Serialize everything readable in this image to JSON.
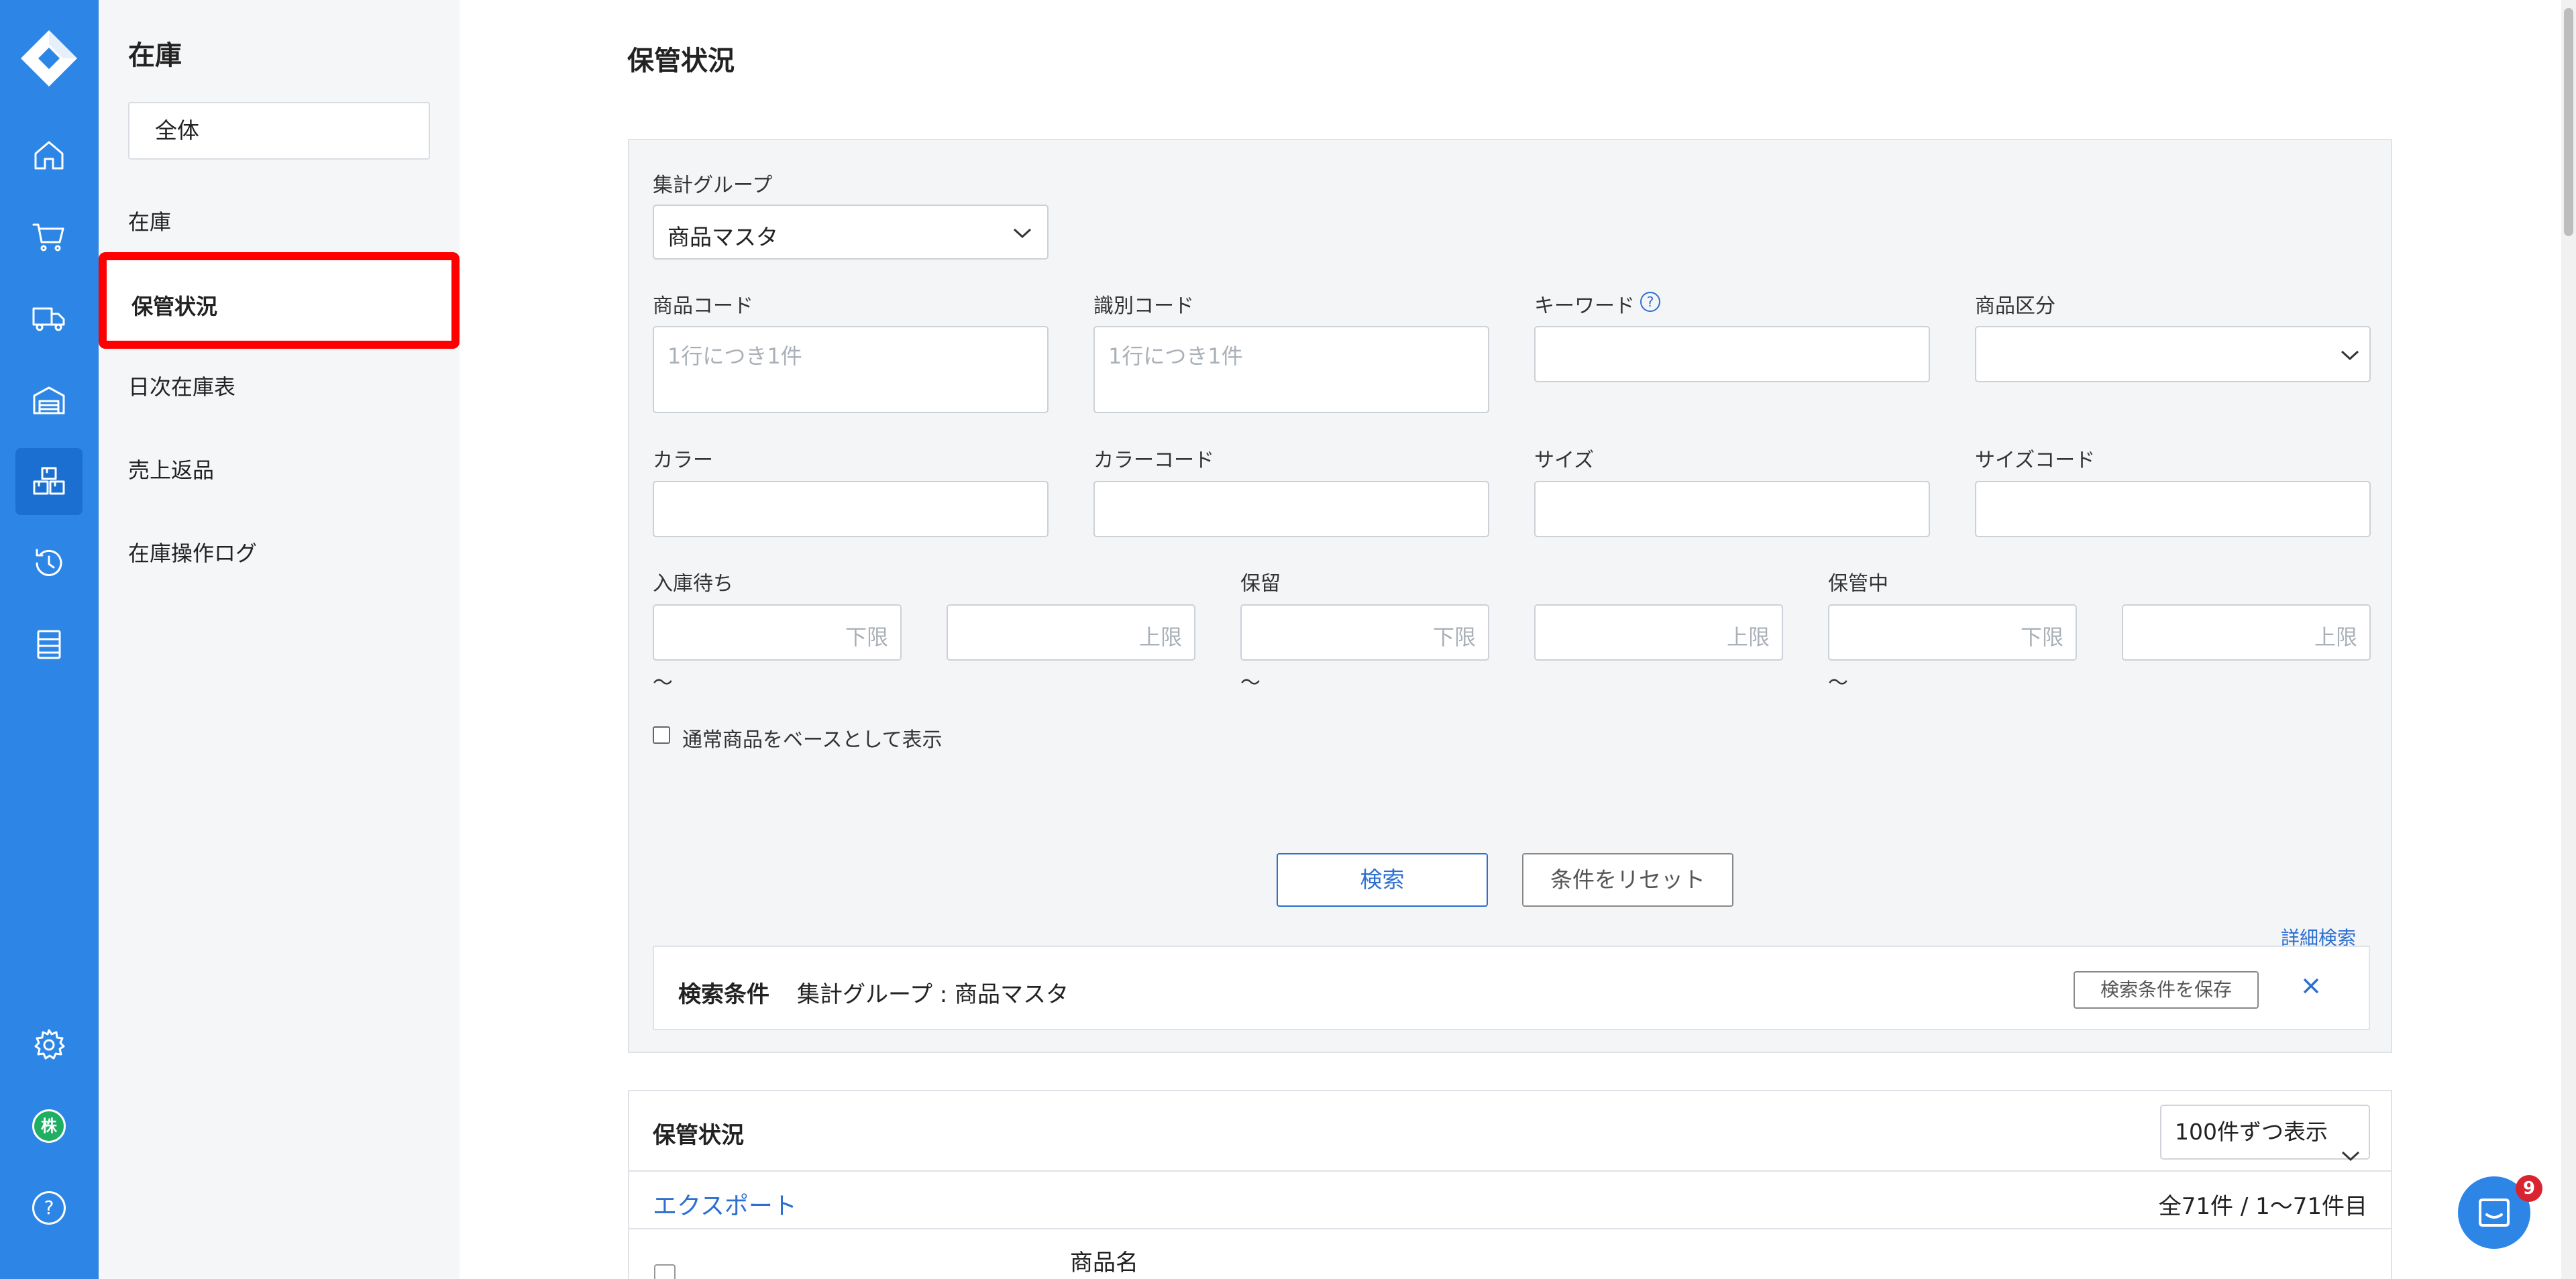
{
  "rail": {
    "items": [
      {
        "name": "home-icon"
      },
      {
        "name": "cart-icon"
      },
      {
        "name": "truck-icon"
      },
      {
        "name": "warehouse-icon"
      },
      {
        "name": "inventory-boxes-icon",
        "active": true
      },
      {
        "name": "history-icon"
      },
      {
        "name": "list-icon"
      }
    ],
    "bottom": [
      {
        "name": "gear-icon"
      },
      {
        "name": "company-avatar",
        "label": "株"
      },
      {
        "name": "help-icon",
        "label": "?"
      }
    ],
    "accent": "#2d86e5"
  },
  "sidebar": {
    "title": "在庫",
    "scope_select": "全体",
    "items": [
      "在庫",
      "保管状況",
      "日次在庫表",
      "売上返品",
      "在庫操作ログ"
    ],
    "active_index": 1,
    "highlight_color": "#ff0000"
  },
  "page": {
    "title": "保管状況"
  },
  "filter": {
    "group_label": "集計グループ",
    "group_value": "商品マスタ",
    "product_code": {
      "label": "商品コード",
      "placeholder": "1行につき1件"
    },
    "identify_code": {
      "label": "識別コード",
      "placeholder": "1行につき1件"
    },
    "keyword": {
      "label": "キーワード",
      "value": ""
    },
    "product_category": {
      "label": "商品区分",
      "value": ""
    },
    "color": {
      "label": "カラー",
      "value": ""
    },
    "color_code": {
      "label": "カラーコード",
      "value": ""
    },
    "size": {
      "label": "サイズ",
      "value": ""
    },
    "size_code": {
      "label": "サイズコード",
      "value": ""
    },
    "ranges": [
      {
        "label": "入庫待ち",
        "min_placeholder": "下限",
        "max_placeholder": "上限"
      },
      {
        "label": "保留",
        "min_placeholder": "下限",
        "max_placeholder": "上限"
      },
      {
        "label": "保管中",
        "min_placeholder": "下限",
        "max_placeholder": "上限"
      }
    ],
    "tilde": "〜",
    "base_checkbox_label": "通常商品をベースとして表示",
    "advanced_search": "詳細検索",
    "search_button": "検索",
    "reset_button": "条件をリセット",
    "condition_label": "検索条件",
    "condition_text": "集計グループ : 商品マスタ",
    "save_condition_button": "検索条件を保存"
  },
  "results": {
    "title": "保管状況",
    "per_page": "100件ずつ表示",
    "export": "エクスポート",
    "count": "全71件 / 1〜71件目",
    "columns": [
      "商品名"
    ]
  },
  "chat": {
    "badge": "9"
  }
}
